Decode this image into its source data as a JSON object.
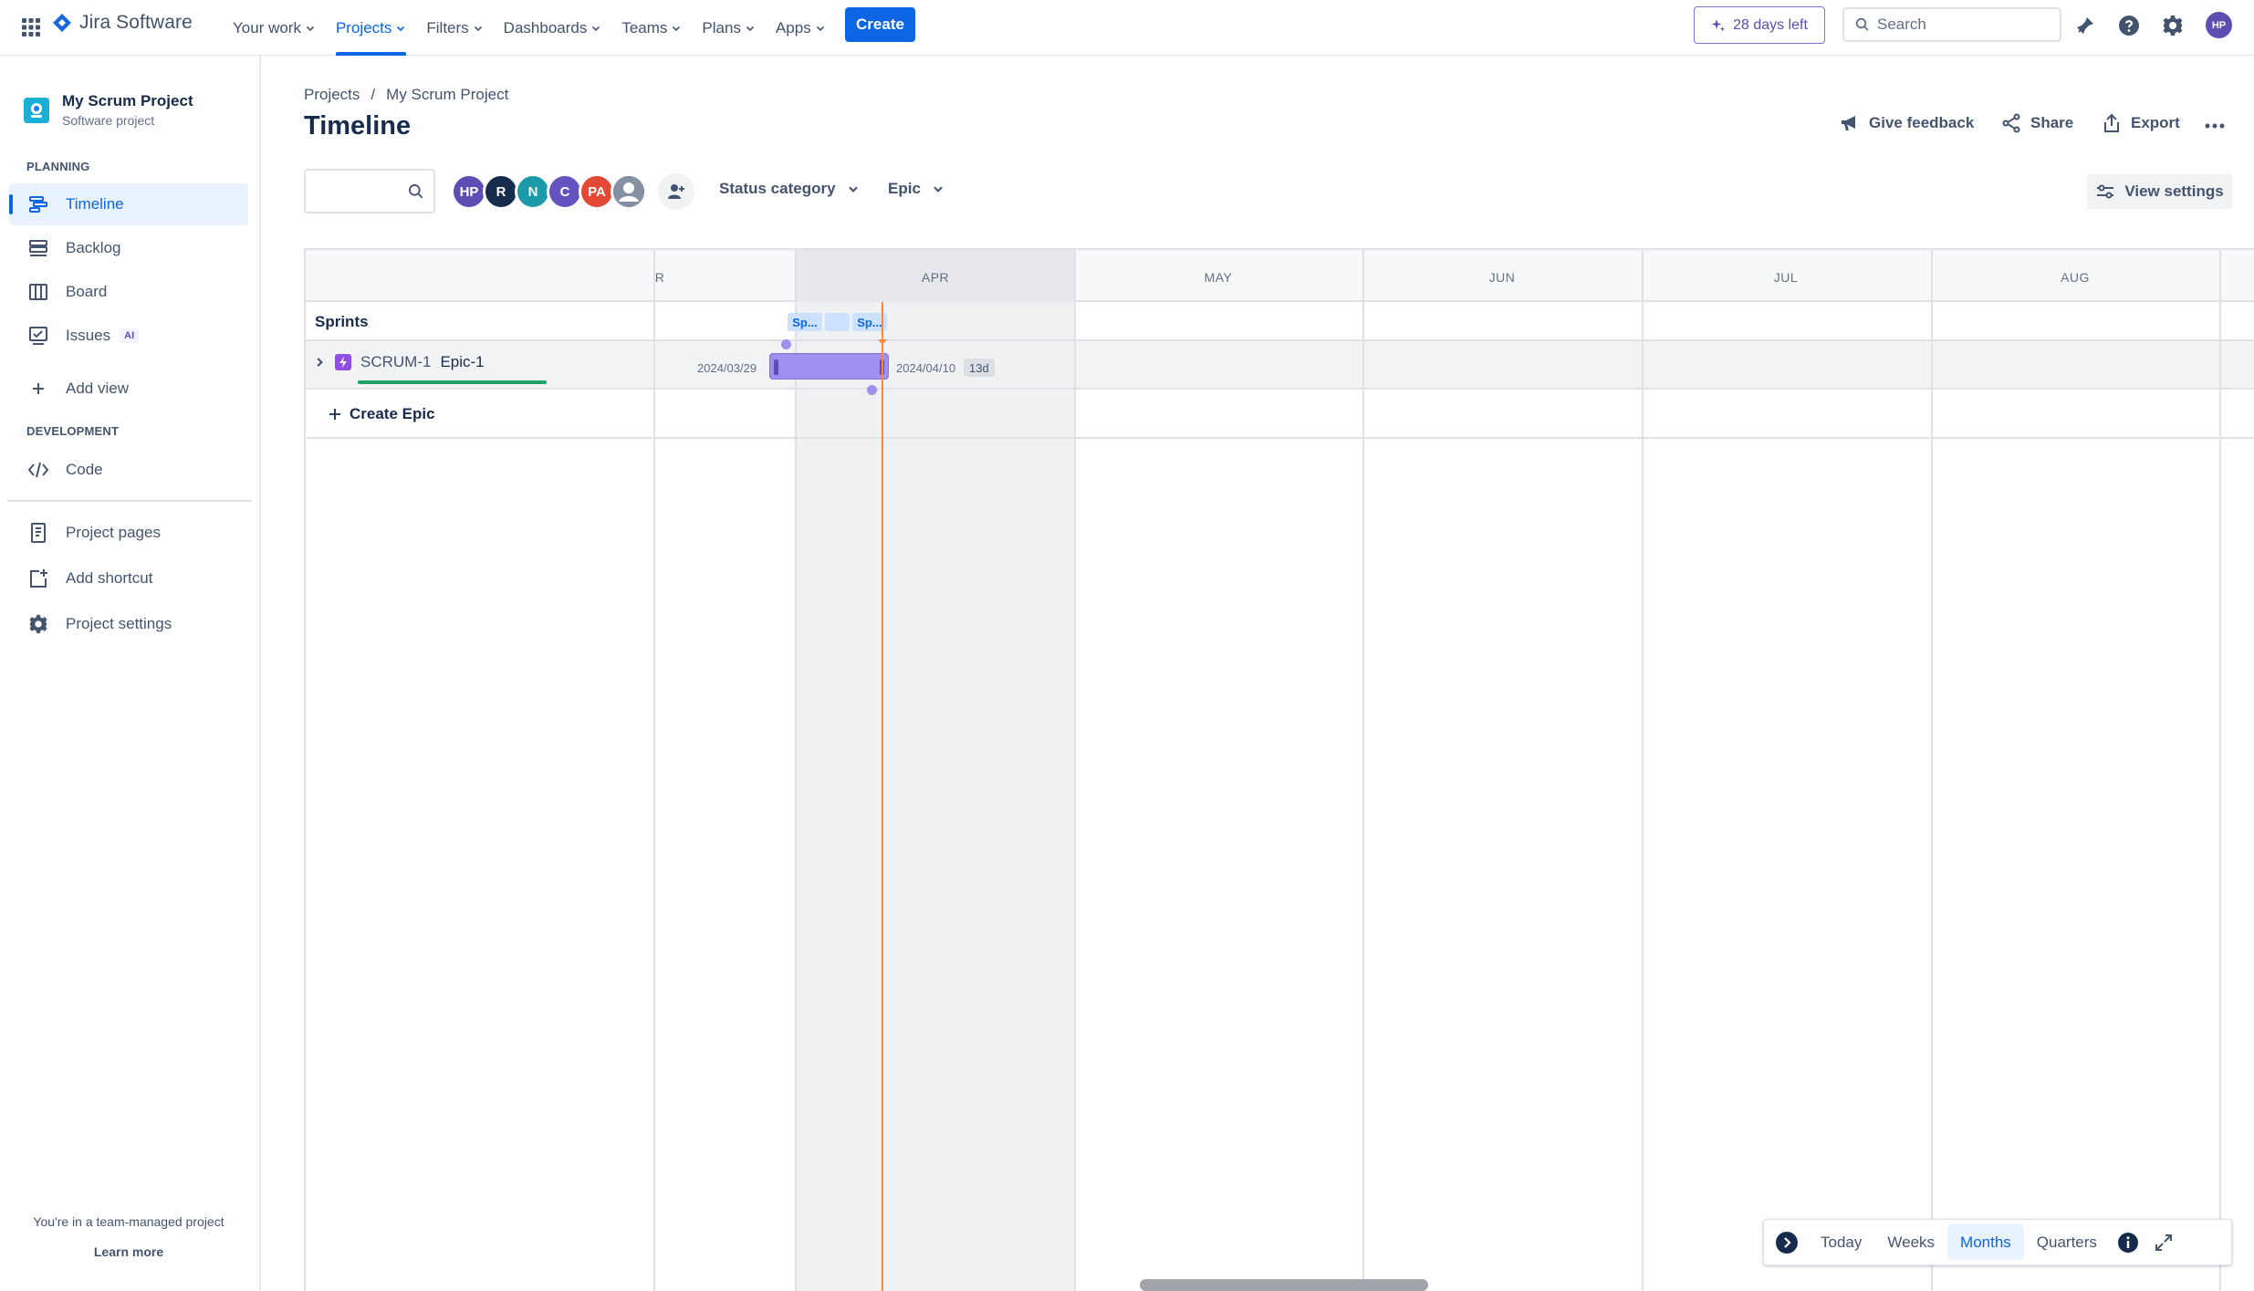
{
  "app": {
    "name": "Jira Software"
  },
  "nav": {
    "items": [
      {
        "label": "Your work",
        "active": false
      },
      {
        "label": "Projects",
        "active": true
      },
      {
        "label": "Filters",
        "active": false
      },
      {
        "label": "Dashboards",
        "active": false
      },
      {
        "label": "Teams",
        "active": false
      },
      {
        "label": "Plans",
        "active": false
      },
      {
        "label": "Apps",
        "active": false
      }
    ],
    "create_label": "Create",
    "trial_label": "28 days left",
    "search_placeholder": "Search",
    "user_initials": "HP"
  },
  "sidebar": {
    "project_name": "My Scrum Project",
    "project_type": "Software project",
    "planning_title": "PLANNING",
    "items": [
      {
        "label": "Timeline",
        "icon": "timeline-icon"
      },
      {
        "label": "Backlog",
        "icon": "backlog-icon"
      },
      {
        "label": "Board",
        "icon": "board-icon"
      },
      {
        "label": "Issues",
        "icon": "issues-icon",
        "badge": "AI"
      },
      {
        "label": "Add view",
        "icon": "plus-icon"
      }
    ],
    "development_title": "DEVELOPMENT",
    "code_label": "Code",
    "project_pages_label": "Project pages",
    "add_shortcut_label": "Add shortcut",
    "project_settings_label": "Project settings",
    "footer_text": "You're in a team-managed project",
    "learn_more": "Learn more"
  },
  "main": {
    "breadcrumb": [
      "Projects",
      "My Scrum Project"
    ],
    "breadcrumb_sep": "/",
    "title": "Timeline",
    "actions": {
      "feedback": "Give feedback",
      "share": "Share",
      "export": "Export"
    },
    "filters": {
      "avatars": [
        {
          "initials": "HP",
          "color": "#5e4db2"
        },
        {
          "initials": "R",
          "color": "#172b4d"
        },
        {
          "initials": "N",
          "color": "#1d9aaa"
        },
        {
          "initials": "C",
          "color": "#6554c0"
        },
        {
          "initials": "PA",
          "color": "#e34935"
        }
      ],
      "status_category": "Status category",
      "epic": "Epic",
      "view_settings": "View settings"
    }
  },
  "timeline": {
    "months": [
      "R",
      "APR",
      "MAY",
      "JUN",
      "JUL",
      "AUG"
    ],
    "sprints_label": "Sprints",
    "sprints": [
      "Sp...",
      "",
      "Sp..."
    ],
    "epic": {
      "key": "SCRUM-1",
      "summary": "Epic-1",
      "start": "2024/03/29",
      "end": "2024/04/10",
      "duration": "13d",
      "progress": 1.0
    },
    "create_epic": "Create Epic"
  },
  "controls": {
    "today": "Today",
    "weeks": "Weeks",
    "months": "Months",
    "quarters": "Quarters",
    "active": "Months"
  },
  "colors": {
    "accent": "#0c66e4",
    "epic": "#9f8fef",
    "today_line": "#f38a3f",
    "progress": "#22a06b"
  }
}
